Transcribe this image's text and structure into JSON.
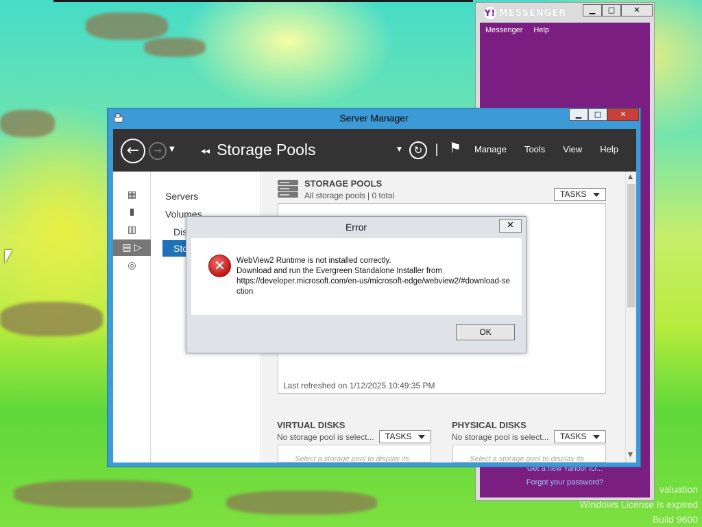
{
  "desktop": {
    "watermark": {
      "line1": "valuation",
      "line2": "Windows License is expired",
      "line3": "Build 9600"
    }
  },
  "messenger": {
    "title": "MESSENGER",
    "logo_letter": "Y!",
    "menu": [
      "Messenger",
      "Help"
    ],
    "link_new": "Get a new Yahoo! ID...",
    "link_forgot": "Forgot your password?",
    "window_buttons": {
      "minimize": "▁",
      "maximize": "□",
      "close": "✕"
    }
  },
  "server_manager": {
    "title": "Server Manager",
    "breadcrumb": "Storage Pools",
    "breadcrumb_arrows": "◂◂",
    "menu": [
      "Manage",
      "Tools",
      "View",
      "Help"
    ],
    "nav_items": {
      "servers": "Servers",
      "volumes": "Volumes",
      "disks": "Dis",
      "storage": "Sto"
    },
    "storage_pools": {
      "title": "STORAGE POOLS",
      "subtitle": "All storage pools | 0 total",
      "tasks": "TASKS",
      "last_refreshed": "Last refreshed on 1/12/2025 10:49:35 PM"
    },
    "virtual_disks": {
      "title": "VIRTUAL DISKS",
      "subtitle": "No storage pool is select...",
      "tasks": "TASKS",
      "placeholder": "Select a storage pool to display its"
    },
    "physical_disks": {
      "title": "PHYSICAL DISKS",
      "subtitle": "No storage pool is select...",
      "tasks": "TASKS",
      "placeholder": "Select a storage pool to display its"
    },
    "window_buttons": {
      "minimize": "▁",
      "maximize": "□",
      "close": "✕"
    }
  },
  "error_dialog": {
    "title": "Error",
    "close": "✕",
    "icon_glyph": "✕",
    "message_line1": "WebView2 Runtime is not installed correctly.",
    "message_line2": "Download and run the Evergreen Standalone Installer from",
    "message_line3": "https://developer.microsoft.com/en-us/microsoft-edge/webview2/#download-section",
    "ok": "OK"
  }
}
